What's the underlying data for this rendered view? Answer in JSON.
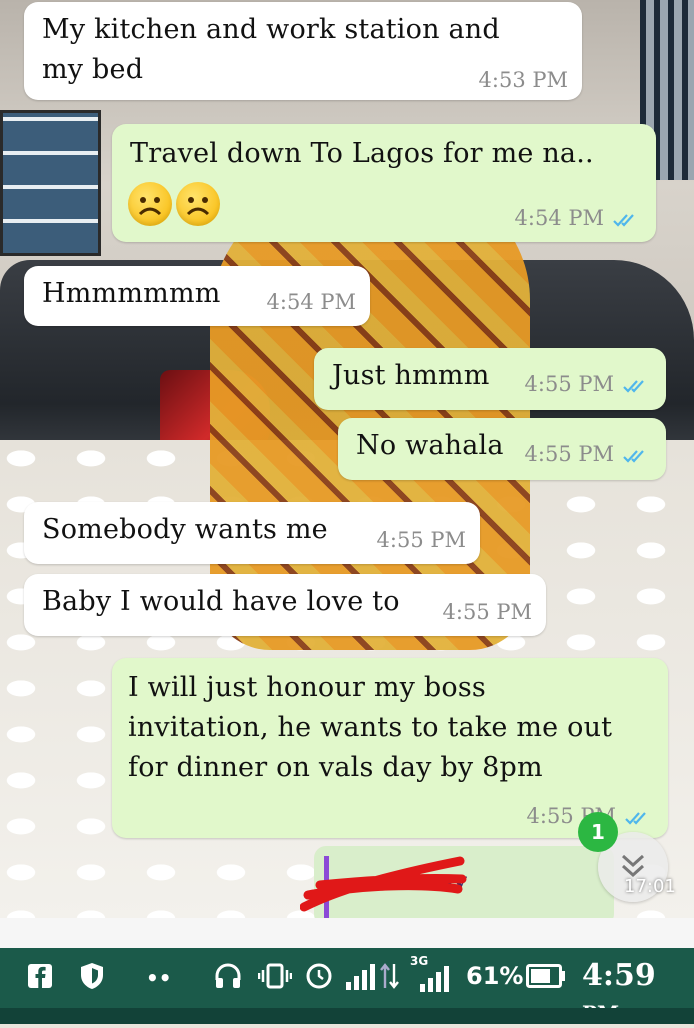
{
  "messages": [
    {
      "dir": "in",
      "lines": [
        "My kitchen and work station and",
        "my bed"
      ],
      "time": "4:53 PM"
    },
    {
      "dir": "out",
      "lines": [
        "Travel down To Lagos for me na.."
      ],
      "emoji": [
        "sad-face",
        "sad-face"
      ],
      "time": "4:54 PM",
      "status": "read"
    },
    {
      "dir": "in",
      "lines": [
        "Hmmmmmm"
      ],
      "time": "4:54 PM"
    },
    {
      "dir": "out",
      "lines": [
        "Just hmmm"
      ],
      "time": "4:55 PM",
      "status": "read"
    },
    {
      "dir": "out",
      "lines": [
        "No wahala"
      ],
      "time": "4:55 PM",
      "status": "read"
    },
    {
      "dir": "in",
      "lines": [
        "Somebody wants me"
      ],
      "time": "4:55 PM"
    },
    {
      "dir": "in",
      "lines": [
        "Baby I would have love to"
      ],
      "time": "4:55 PM"
    },
    {
      "dir": "out",
      "lines": [
        "I will just honour my boss",
        "invitation,  he wants to take me out",
        "for dinner on vals day by 8pm"
      ],
      "time": "4:55 PM",
      "status": "read"
    }
  ],
  "unread_count": "1",
  "video_timestamp": "17:01",
  "partial_quote_name": "...mmy",
  "statusbar": {
    "network": "3G",
    "battery_percent": "61%",
    "clock": "4:59",
    "clock_suffix": "PM"
  },
  "colors": {
    "incoming_bubble": "#ffffff",
    "outgoing_bubble": "#e1f8cb",
    "read_ticks": "#4fb6ec",
    "statusbar": "#1b5a4a",
    "unread_badge": "#2cb742"
  }
}
